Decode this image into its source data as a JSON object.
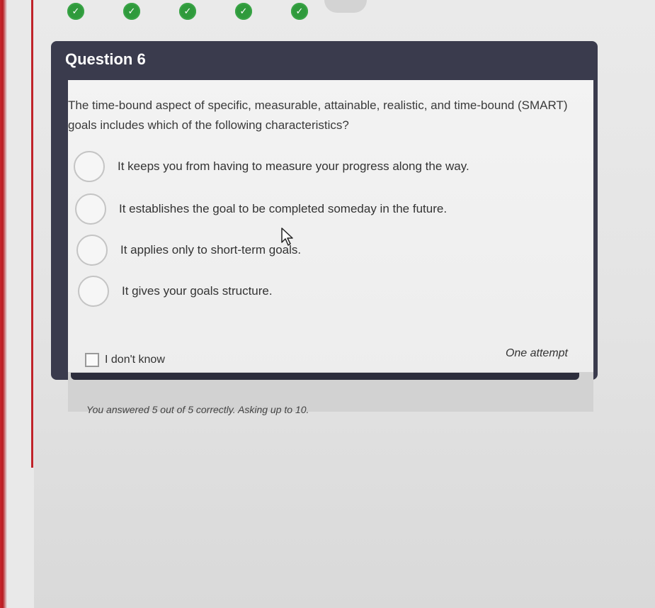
{
  "progress": {
    "completed_count": 5,
    "markers": [
      "check-icon",
      "check-icon",
      "check-icon",
      "check-icon",
      "check-icon"
    ],
    "complete_color": "#2f9a3c"
  },
  "question": {
    "title": "Question 6",
    "text": "The time-bound aspect of specific, measurable, attainable, realistic, and time-bound (SMART) goals includes which of the following characteristics?",
    "options": [
      "It keeps you from having to measure your progress along the way.",
      "It establishes the goal to be completed someday in the future.",
      "It applies only to short-term goals.",
      "It gives your goals structure."
    ],
    "dont_know_label": "I don't know",
    "attempts_label": "One attempt"
  },
  "status": {
    "score_text": "You answered 5 out of 5 correctly. Asking up to 10."
  },
  "theme": {
    "header_bg": "#3a3b4d",
    "accent_red": "#c0232a"
  }
}
